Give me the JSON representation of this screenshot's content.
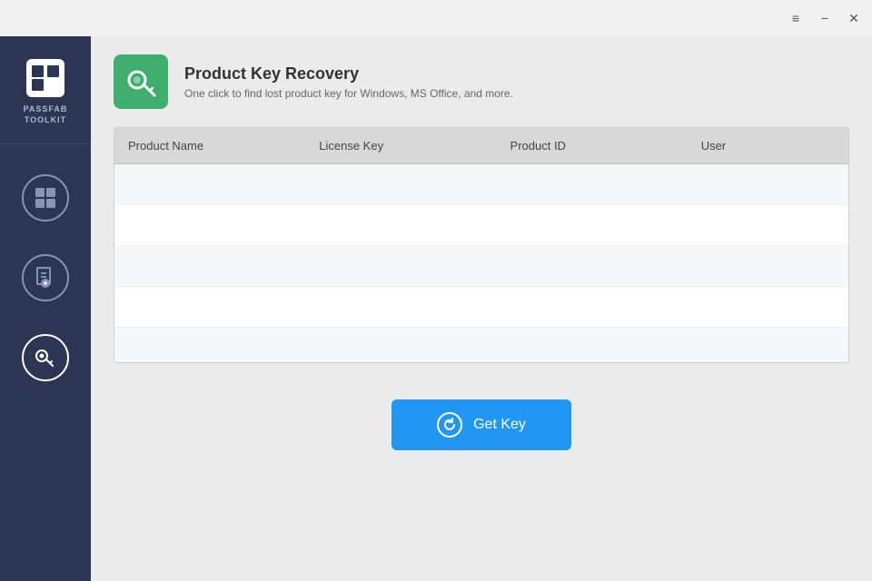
{
  "titlebar": {
    "menu_icon": "≡",
    "minimize_icon": "−",
    "close_icon": "✕"
  },
  "sidebar": {
    "logo_line1": "PASSFAB",
    "logo_line2": "TOOLKIT",
    "items": [
      {
        "id": "windows",
        "label": "Windows Key",
        "active": false
      },
      {
        "id": "file",
        "label": "File Key",
        "active": false
      },
      {
        "id": "product",
        "label": "Product Key",
        "active": true
      }
    ]
  },
  "header": {
    "title": "Product Key Recovery",
    "description": "One click to find lost product key for Windows, MS Office, and more."
  },
  "table": {
    "columns": [
      "Product Name",
      "License Key",
      "Product ID",
      "User"
    ],
    "rows": [
      {
        "product_name": "",
        "license_key": "",
        "product_id": "",
        "user": ""
      },
      {
        "product_name": "",
        "license_key": "",
        "product_id": "",
        "user": ""
      },
      {
        "product_name": "",
        "license_key": "",
        "product_id": "",
        "user": ""
      },
      {
        "product_name": "",
        "license_key": "",
        "product_id": "",
        "user": ""
      },
      {
        "product_name": "",
        "license_key": "",
        "product_id": "",
        "user": ""
      }
    ]
  },
  "button": {
    "get_key_label": "Get Key"
  },
  "colors": {
    "sidebar_bg": "#2d3554",
    "green_icon_bg": "#3dae6e",
    "button_blue": "#2196f3"
  }
}
